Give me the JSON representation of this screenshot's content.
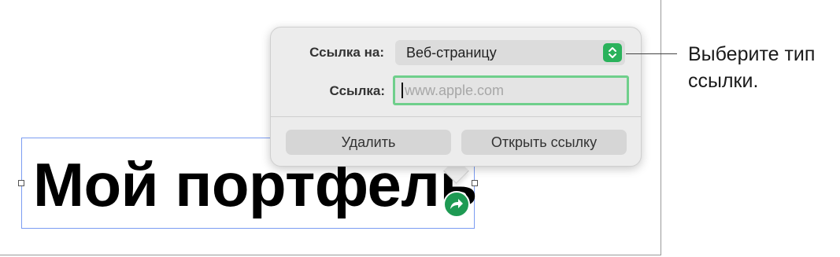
{
  "document": {
    "title_text": "Мой портфель"
  },
  "link_popover": {
    "link_to_label": "Ссылка на:",
    "link_to_value": "Веб-страницу",
    "link_label": "Ссылка:",
    "link_placeholder": "www.apple.com",
    "delete_button": "Удалить",
    "open_link_button": "Открыть ссылку"
  },
  "callout": {
    "line1": "Выберите тип",
    "line2": "ссылки."
  },
  "icons": {
    "link_badge": "link-arrow-icon",
    "select_stepper": "chevron-updown-icon"
  },
  "colors": {
    "selection_border": "#7b9cf2",
    "green_accent": "#2ab25b",
    "focus_ring": "#6fcf8b",
    "popover_bg": "#ececec"
  }
}
